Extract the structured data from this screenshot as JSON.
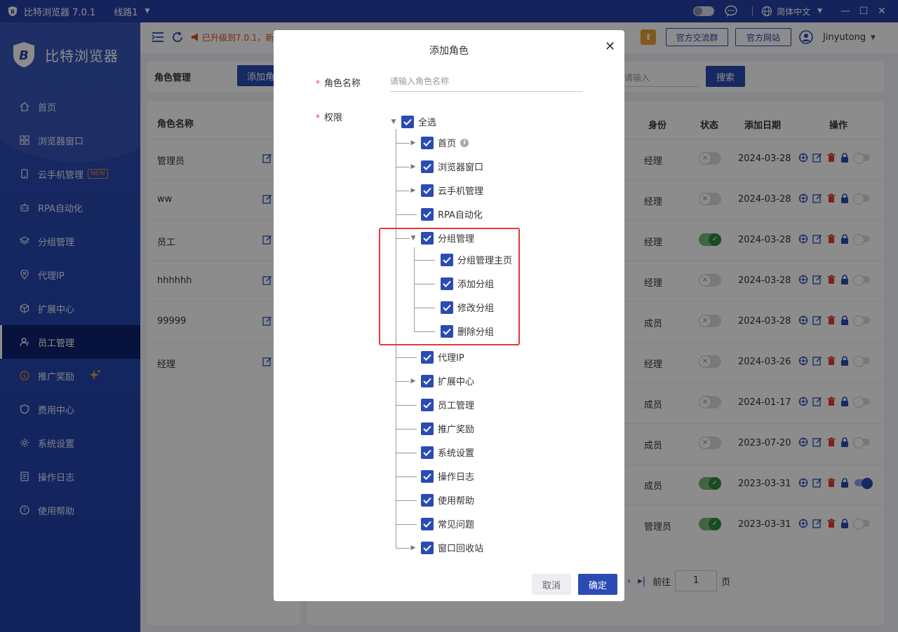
{
  "titlebar": {
    "app_title": "比特浏览器 7.0.1",
    "line": "线路1",
    "language": "简体中文"
  },
  "sidebar": {
    "logo_text": "比特浏览器",
    "items": [
      {
        "label": "首页",
        "icon": "home-icon"
      },
      {
        "label": "浏览器窗口",
        "icon": "grid-icon"
      },
      {
        "label": "云手机管理",
        "icon": "phone-icon",
        "badge": "NEW"
      },
      {
        "label": "RPA自动化",
        "icon": "robot-icon"
      },
      {
        "label": "分组管理",
        "icon": "layers-icon"
      },
      {
        "label": "代理IP",
        "icon": "location-icon"
      },
      {
        "label": "扩展中心",
        "icon": "cube-icon"
      },
      {
        "label": "员工管理",
        "icon": "users-icon",
        "active": true
      },
      {
        "label": "推广奖励",
        "icon": "dollar-icon"
      },
      {
        "label": "费用中心",
        "icon": "shield-icon"
      },
      {
        "label": "系统设置",
        "icon": "gear-icon"
      },
      {
        "label": "操作日志",
        "icon": "log-icon"
      },
      {
        "label": "使用帮助",
        "icon": "help-icon"
      }
    ]
  },
  "topbar": {
    "notice": "已升级到7.0.1，新",
    "group_btn": "官方交流群",
    "site_btn": "官方网站",
    "username": "Jinyutong"
  },
  "role_page": {
    "title": "角色管理",
    "add_btn": "添加角",
    "search_placeholder": "请输入",
    "search_btn": "搜索",
    "left_header": "角色名称",
    "roles": [
      "管理员",
      "ww",
      "员工",
      "hhhhhh",
      "99999",
      "经理"
    ],
    "columns": {
      "identity": "身份",
      "status": "状态",
      "date": "添加日期",
      "ops": "操作"
    },
    "rows": [
      {
        "identity": "经理",
        "status": false,
        "date": "2024-03-28",
        "toggle": false
      },
      {
        "identity": "经理",
        "status": false,
        "date": "2024-03-28",
        "toggle": false
      },
      {
        "identity": "经理",
        "status": true,
        "date": "2024-03-28",
        "toggle": false
      },
      {
        "identity": "经理",
        "status": false,
        "date": "2024-03-28",
        "toggle": false
      },
      {
        "identity": "成员",
        "status": false,
        "date": "2024-03-28",
        "toggle": false
      },
      {
        "identity": "经理",
        "status": false,
        "date": "2024-03-26",
        "toggle": false
      },
      {
        "identity": "成员",
        "status": false,
        "date": "2024-01-17",
        "toggle": false
      },
      {
        "identity": "成员",
        "status": false,
        "date": "2023-07-20",
        "toggle": false
      },
      {
        "identity": "成员",
        "status": true,
        "date": "2023-03-31",
        "toggle": true
      },
      {
        "identity": "管理员",
        "status": true,
        "date": "2023-03-31",
        "toggle": false
      }
    ],
    "pager": {
      "prefix": "前往",
      "page": "1",
      "suffix": "页"
    }
  },
  "modal": {
    "title": "添加角色",
    "name_label": "角色名称",
    "name_placeholder": "请输入角色名称",
    "perm_label": "权限",
    "select_all": "全选",
    "perms": [
      {
        "label": "首页",
        "has_children": true,
        "info": true
      },
      {
        "label": "浏览器窗口",
        "has_children": true
      },
      {
        "label": "云手机管理",
        "has_children": true
      },
      {
        "label": "RPA自动化",
        "has_children": false
      },
      {
        "label": "分组管理",
        "has_children": true,
        "expanded": true,
        "children": [
          "分组管理主页",
          "添加分组",
          "修改分组",
          "删除分组"
        ]
      },
      {
        "label": "代理IP",
        "has_children": false
      },
      {
        "label": "扩展中心",
        "has_children": true
      },
      {
        "label": "员工管理",
        "has_children": false
      },
      {
        "label": "推广奖励",
        "has_children": false
      },
      {
        "label": "系统设置",
        "has_children": false
      },
      {
        "label": "操作日志",
        "has_children": false
      },
      {
        "label": "使用帮助",
        "has_children": false
      },
      {
        "label": "常见问题",
        "has_children": false
      },
      {
        "label": "窗口回收站",
        "has_children": true
      }
    ],
    "cancel": "取消",
    "ok": "确定"
  },
  "colors": {
    "primary": "#2a4bb4",
    "sidebar": "#2240a8",
    "active_nav": "#0e2170",
    "danger": "#e53935",
    "success": "#2e8b3a",
    "warning": "#e8a23a"
  }
}
